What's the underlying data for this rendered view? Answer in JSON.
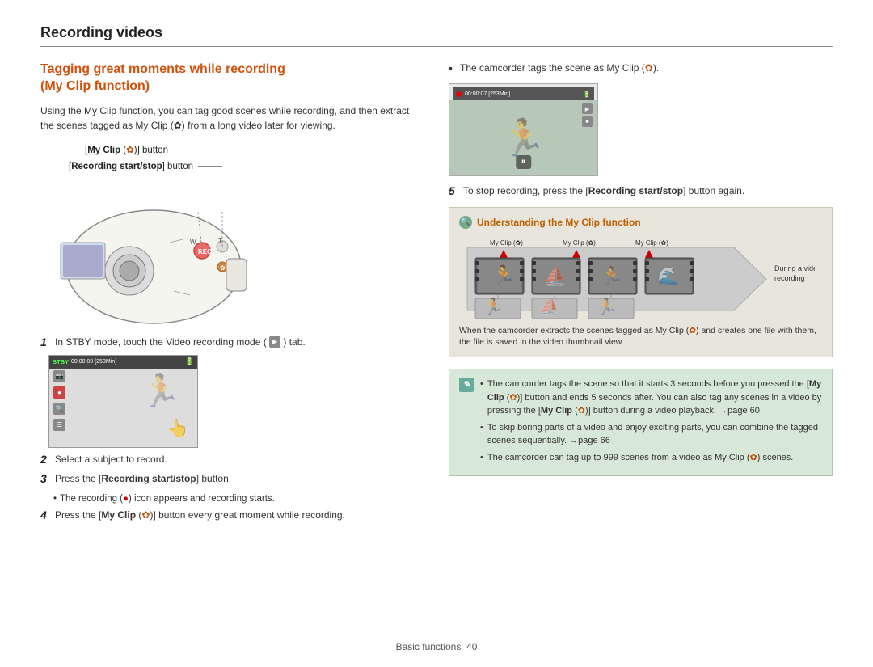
{
  "header": {
    "title": "Recording videos"
  },
  "left_column": {
    "section_title": "Tagging great moments while recording\n(My Clip function)",
    "intro_text": "Using the My Clip function, you can tag good scenes while recording, and then extract the scenes tagged as My Clip (✿) from a long video later for viewing.",
    "myclip_button_label": "[My Clip (✿)] button",
    "record_button_label": "[Recording start/stop] button",
    "steps": [
      {
        "num": "1",
        "text": "In STBY mode, touch the Video recording mode (",
        "text2": ") tab."
      },
      {
        "num": "2",
        "text": "Select a subject to record."
      },
      {
        "num": "3",
        "text": "Press the [Recording start/stop] button."
      },
      {
        "num": "3",
        "bullet": "The recording (●) icon appears and recording starts."
      },
      {
        "num": "4",
        "text": "Press the [My Clip (✿)] button every great moment while recording."
      }
    ],
    "stby_screen": {
      "label": "STBY",
      "time": "00:00:00 [253Min]"
    }
  },
  "right_column": {
    "bullet1": "The camcorder tags the scene as My Clip (✿).",
    "step5_text": "To stop recording, press the [Recording start/stop] button again.",
    "understanding_title": "Understanding the My Clip function",
    "understanding_labels": [
      "My Clip (✿)",
      "My Clip (✿)",
      "My Clip (✿)"
    ],
    "during_label": "During a video\nrecording",
    "understanding_desc": "When the camcorder extracts the scenes tagged as My Clip (✿) and creates one file with them, the file is saved in the video thumbnail view.",
    "rec_screen": {
      "time": "00:00:07 [253Min]"
    },
    "notes": [
      "The camcorder tags the scene so that it starts 3 seconds before you pressed the [My Clip (✿)] button and ends 5 seconds after. You can also tag any scenes in a video by pressing the [My Clip (✿)] button during a video playback. →page 60",
      "To skip boring parts of a video and enjoy exciting parts, you can combine the tagged scenes sequentially. →page 66",
      "The camcorder can tag up to 999 scenes from a video as My Clip (✿) scenes."
    ]
  },
  "footer": {
    "text": "Basic functions",
    "page": "40"
  }
}
